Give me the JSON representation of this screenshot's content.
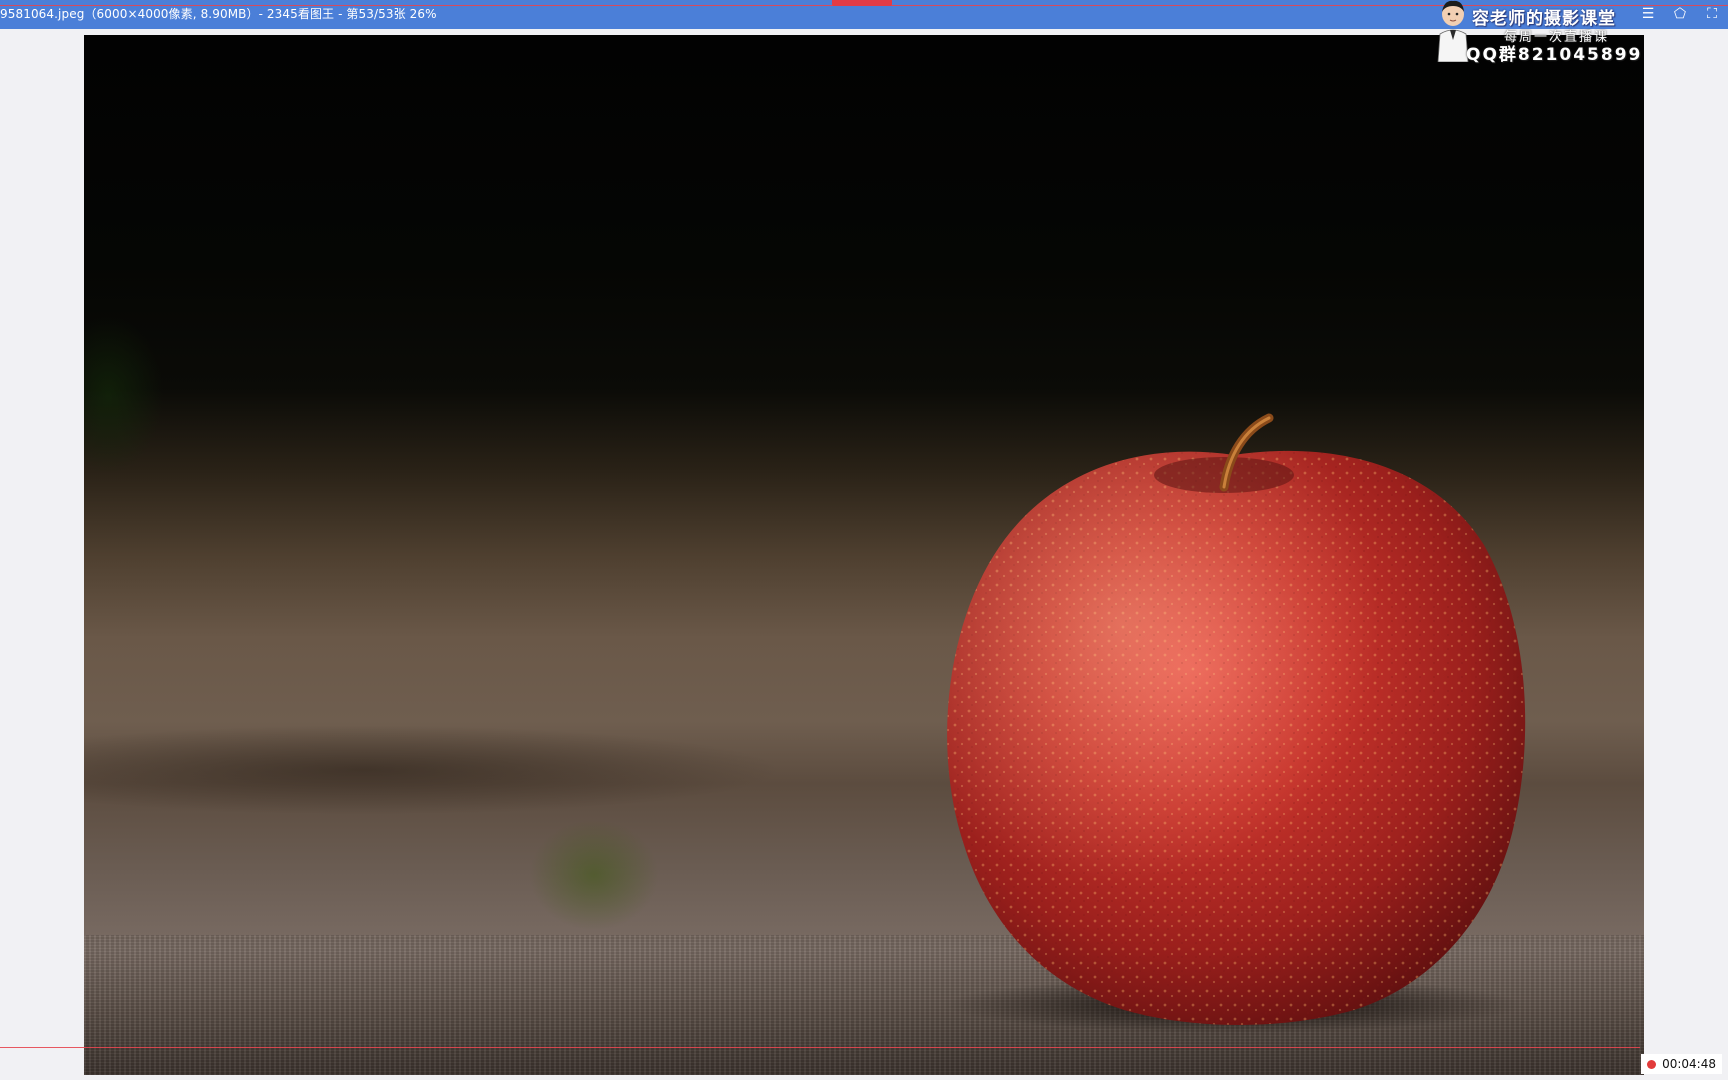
{
  "window": {
    "title": "9581064.jpeg（6000×4000像素, 8.90MB）- 2345看图王 - 第53/53张 26%"
  },
  "window_controls": {
    "menu_icon": "☰",
    "skin_icon": "⬠",
    "fullscreen_icon": "⛶"
  },
  "watermark": {
    "line1": "容老师的摄影课堂",
    "line2": "每周一次直播课",
    "line3": "QQ群821045899"
  },
  "photo": {
    "subject": "apple"
  },
  "recording": {
    "elapsed": "00:04:48",
    "indicator_color": "#e23b3b"
  },
  "colors": {
    "title_bar": "#4b7fd8",
    "viewer_background": "#f1f1f4",
    "accent_red": "#e23b46"
  }
}
